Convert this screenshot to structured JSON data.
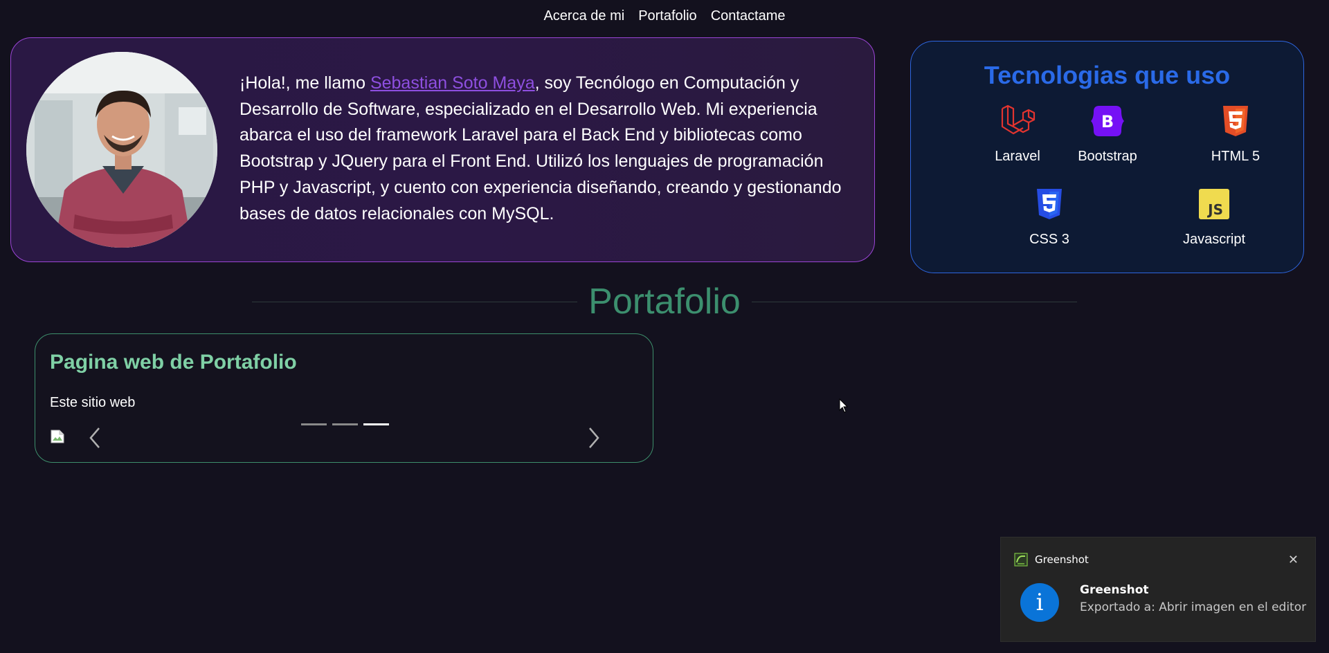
{
  "nav": {
    "about": "Acerca de mi",
    "portfolio": "Portafolio",
    "contact": "Contactame"
  },
  "about": {
    "greeting": "¡Hola!, me llamo ",
    "name": "Sebastian Soto Maya",
    "bio": ", soy Tecnólogo en Computación y Desarrollo de Software, especializado en el Desarrollo Web. Mi experiencia abarca el uso del framework Laravel para el Back End y bibliotecas como Bootstrap y JQuery para el Front End. Utilizó los lenguajes de programación PHP y Javascript, y cuento con experiencia diseñando, creando y gestionando bases de datos relacionales con MySQL."
  },
  "tech": {
    "title": "Tecnologias que uso",
    "items": [
      {
        "label": "Laravel",
        "icon": "laravel-icon",
        "color": "#e3342f"
      },
      {
        "label": "Bootstrap",
        "icon": "bootstrap-icon",
        "color": "#7511f5"
      },
      {
        "label": "HTML 5",
        "icon": "html5-icon",
        "color": "#e44d26"
      },
      {
        "label": "CSS 3",
        "icon": "css3-icon",
        "color": "#264de4"
      },
      {
        "label": "Javascript",
        "icon": "javascript-icon",
        "color": "#f0db4f"
      }
    ]
  },
  "portfolio": {
    "heading": "Portafolio",
    "project": {
      "title": "Pagina web de Portafolio",
      "description": "Este sitio web",
      "active_slide": 3,
      "slide_count": 3
    }
  },
  "toast": {
    "app": "Greenshot",
    "title": "Greenshot",
    "message": "Exportado a: Abrir imagen en el editor",
    "close": "✕"
  },
  "colors": {
    "background": "#13111e",
    "about_border": "#9b45d6",
    "tech_border": "#2d66e0",
    "accent_green": "#3c8f6e",
    "name_link": "#8e4fe0"
  }
}
